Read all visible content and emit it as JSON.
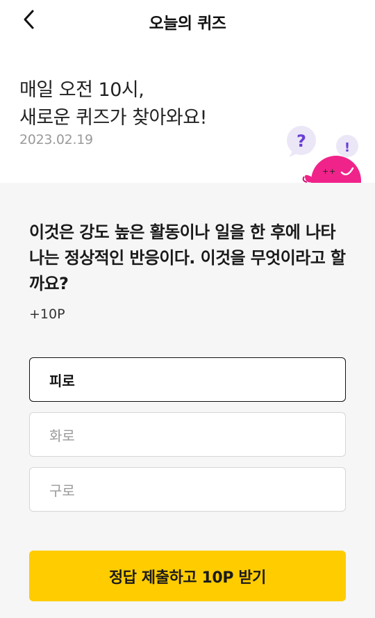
{
  "header": {
    "title": "오늘의 퀴즈",
    "back_icon": "chevron-left-icon"
  },
  "hero": {
    "title_line1": "매일 오전 10시,",
    "title_line2": "새로운 퀴즈가 찾아와요!",
    "date": "2023.02.19",
    "mascot_question_mark": "?",
    "mascot_exclamation": "!"
  },
  "quiz": {
    "question": "이것은 강도 높은 활동이나 일을 한 후에 나타나는 정상적인 반응이다. 이것을 무엇이라고 할까요?",
    "points": "+10P",
    "options": [
      {
        "label": "피로",
        "selected": true
      },
      {
        "label": "화로",
        "selected": false
      },
      {
        "label": "구로",
        "selected": false
      }
    ],
    "submit_label": "정답 제출하고 10P 받기"
  },
  "colors": {
    "accent": "#ffcc00",
    "mascot_pink": "#f0238a",
    "mascot_purple": "#6a3fd4",
    "background_gray": "#f6f6f6"
  }
}
